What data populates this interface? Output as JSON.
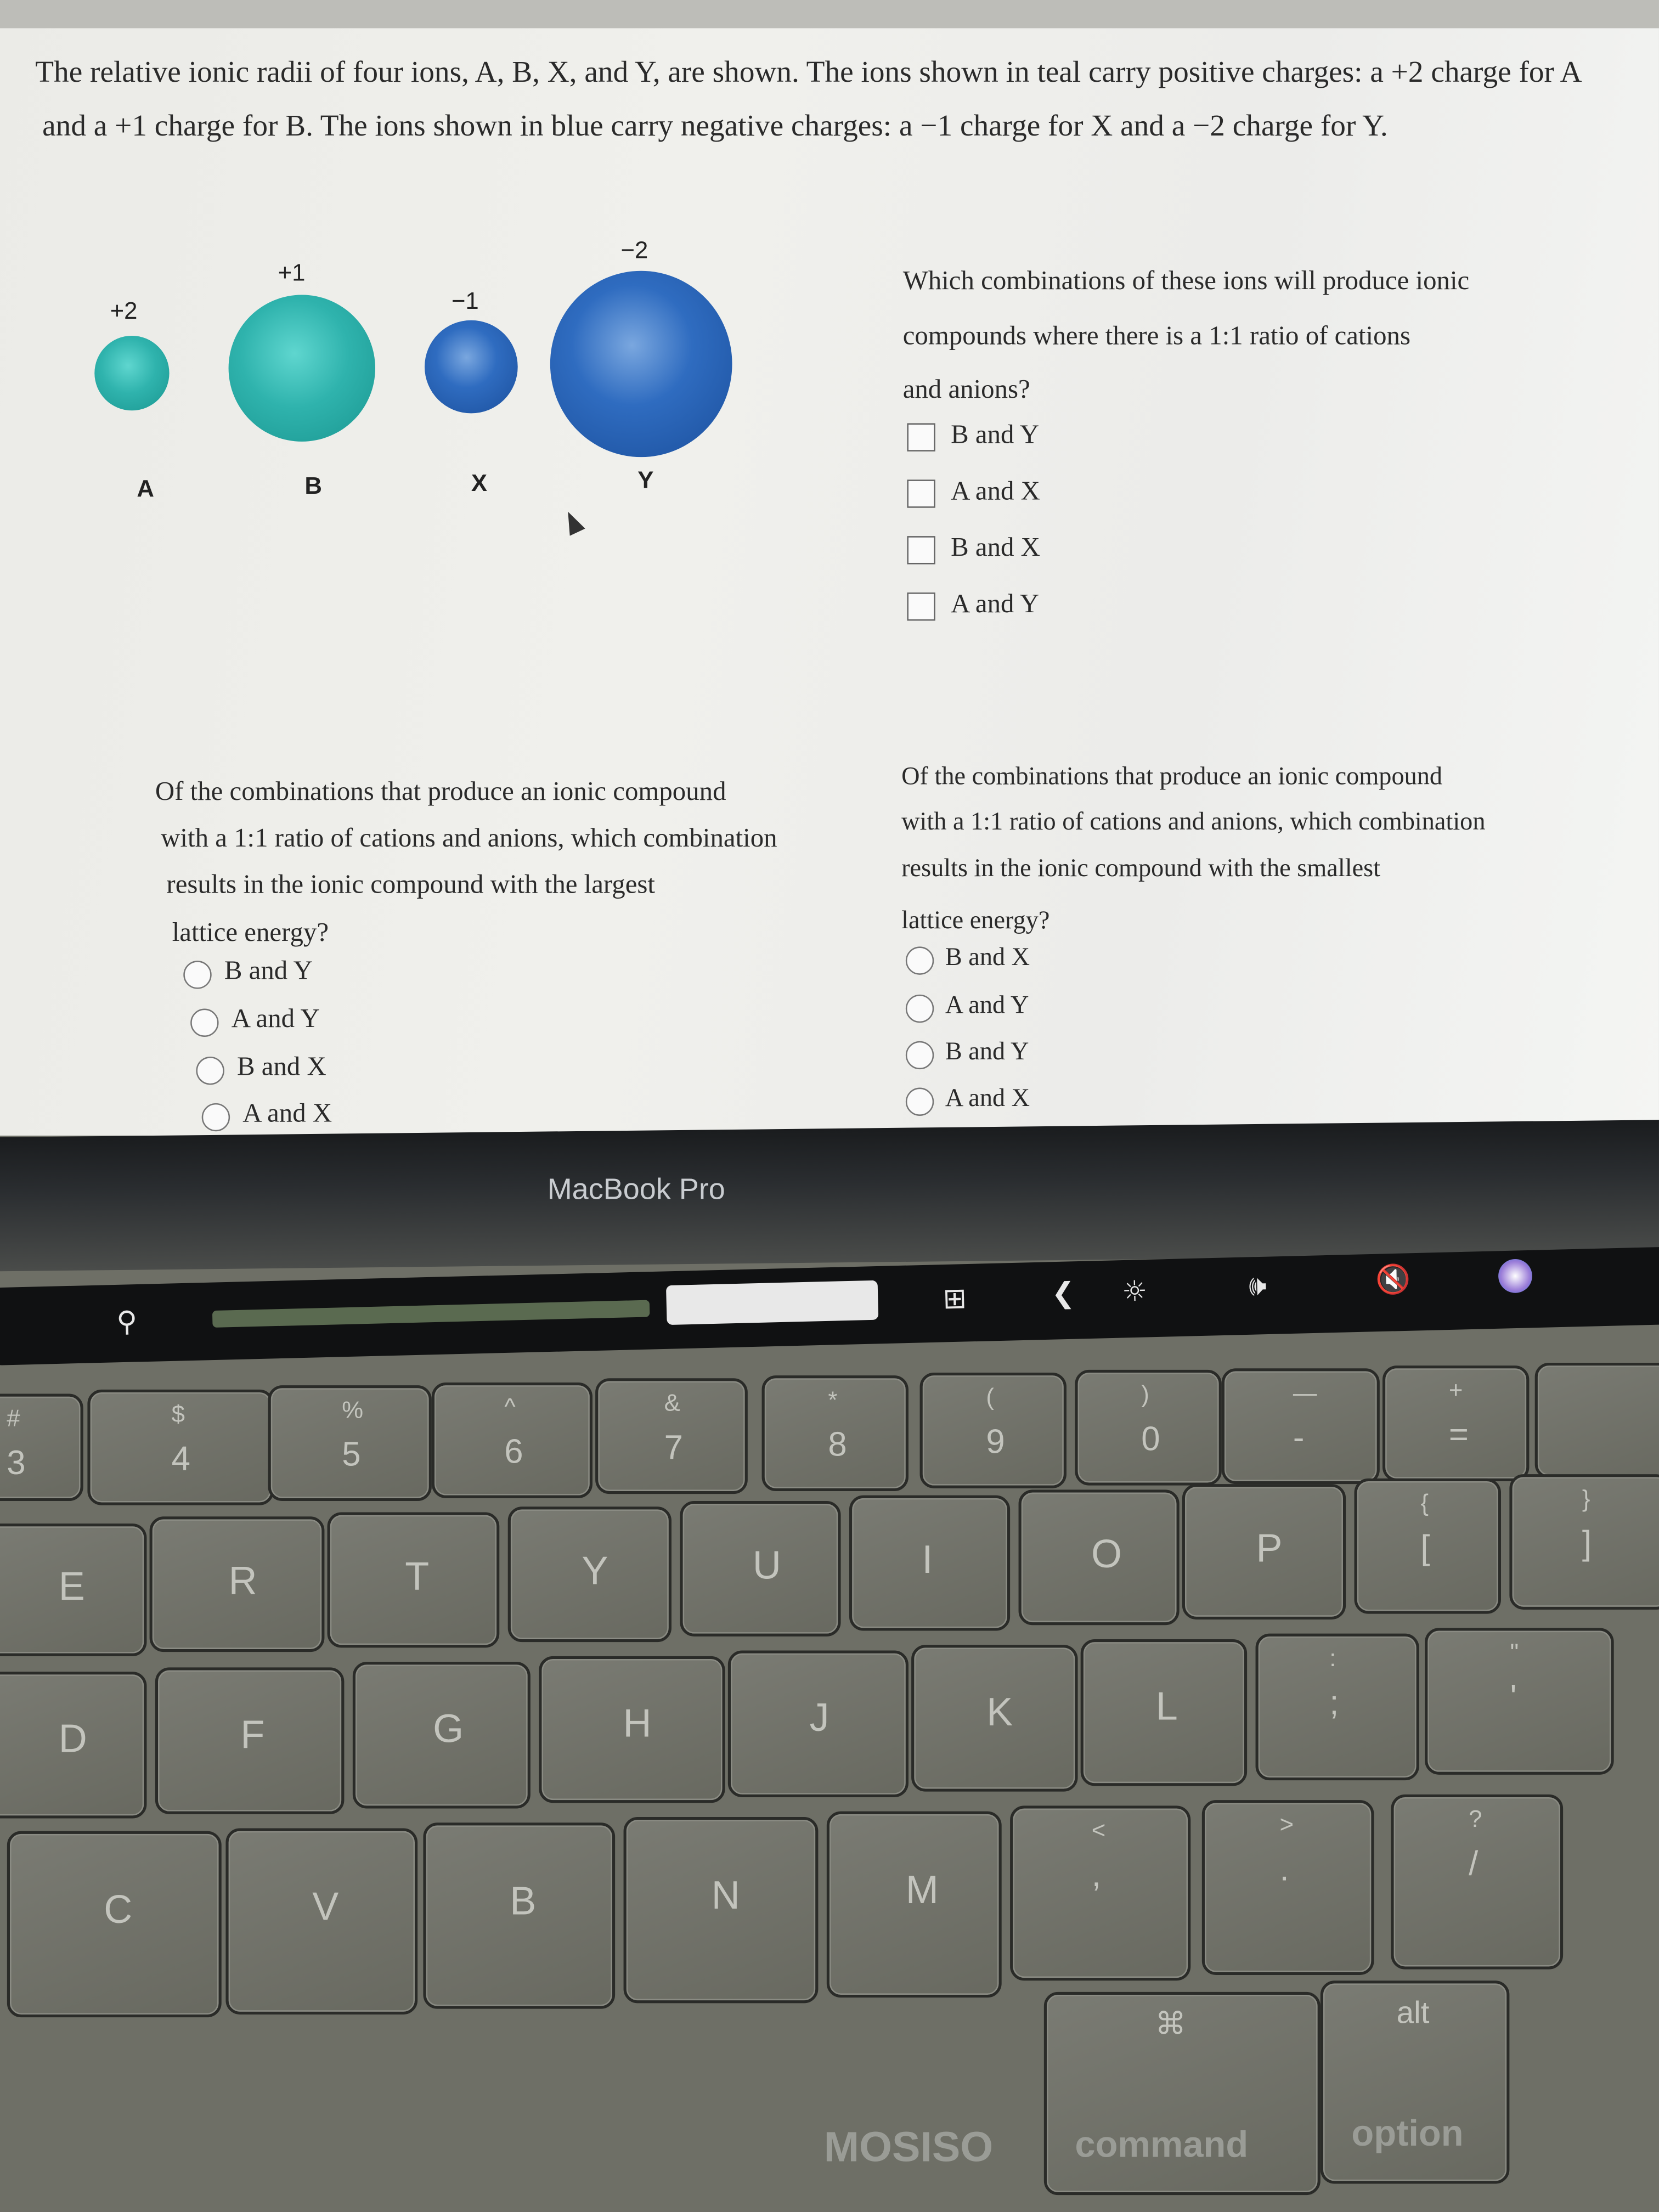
{
  "question_intro": {
    "line1": "The relative ionic radii of four ions, A, B, X, and Y, are shown. The ions shown in teal carry positive charges: a +2 charge for A",
    "line2": "and a +1 charge for B. The ions shown in blue carry negative charges: a −1 charge for X and a −2 charge for Y."
  },
  "ions": [
    {
      "label": "A",
      "charge": "+2",
      "color": "#2fb3ad"
    },
    {
      "label": "B",
      "charge": "+1",
      "color": "#2fb3ad"
    },
    {
      "label": "X",
      "charge": "−1",
      "color": "#2f6cc0"
    },
    {
      "label": "Y",
      "charge": "−2",
      "color": "#2f6cc0"
    }
  ],
  "q1": {
    "lines": [
      "Which combinations of these ions will produce ionic",
      "compounds where there is a 1:1 ratio of cations",
      "and anions?"
    ],
    "options": [
      "B and Y",
      "A and X",
      "B and X",
      "A and Y"
    ]
  },
  "q2": {
    "lines": [
      "Of the combinations that produce an ionic compound",
      "with a 1:1 ratio of cations and anions, which combination",
      "results in the ionic compound with the largest",
      "lattice energy?"
    ],
    "options": [
      "B and Y",
      "A and Y",
      "B and X",
      "A and X"
    ]
  },
  "q3": {
    "lines": [
      "Of the combinations that produce an ionic compound",
      "with a 1:1 ratio of cations and anions, which combination",
      "results in the ionic compound with the smallest",
      "lattice energy?"
    ],
    "options": [
      "B and X",
      "A and Y",
      "B and Y",
      "A and X"
    ]
  },
  "laptop": {
    "bezel_label": "MacBook Pro",
    "case_brand": "MOSISO",
    "touchbar_icons": [
      "search-icon",
      "screenshot-icon",
      "chevron-left-icon",
      "brightness-icon",
      "volume-icon",
      "mute-icon",
      "siri-icon"
    ]
  },
  "keyboard": {
    "keys": [
      {
        "top": "#",
        "main": "3"
      },
      {
        "top": "$",
        "main": "4"
      },
      {
        "top": "%",
        "main": "5"
      },
      {
        "top": "^",
        "main": "6"
      },
      {
        "top": "&",
        "main": "7"
      },
      {
        "top": "*",
        "main": "8"
      },
      {
        "top": "(",
        "main": "9"
      },
      {
        "top": ")",
        "main": "0"
      },
      {
        "top": "—",
        "main": "-"
      },
      {
        "top": "+",
        "main": "="
      },
      {
        "top": "",
        "main": ""
      },
      {
        "top": "",
        "main": "E"
      },
      {
        "top": "",
        "main": "R"
      },
      {
        "top": "",
        "main": "T"
      },
      {
        "top": "",
        "main": "Y"
      },
      {
        "top": "",
        "main": "U"
      },
      {
        "top": "",
        "main": "I"
      },
      {
        "top": "",
        "main": "O"
      },
      {
        "top": "",
        "main": "P"
      },
      {
        "top": "{",
        "main": "["
      },
      {
        "top": "}",
        "main": "]"
      },
      {
        "top": "",
        "main": "D"
      },
      {
        "top": "",
        "main": "F"
      },
      {
        "top": "",
        "main": "G"
      },
      {
        "top": "",
        "main": "H"
      },
      {
        "top": "",
        "main": "J"
      },
      {
        "top": "",
        "main": "K"
      },
      {
        "top": "",
        "main": "L"
      },
      {
        "top": ":",
        "main": ";"
      },
      {
        "top": "\"",
        "main": "'"
      },
      {
        "top": "",
        "main": "C"
      },
      {
        "top": "",
        "main": "V"
      },
      {
        "top": "",
        "main": "B"
      },
      {
        "top": "",
        "main": "N"
      },
      {
        "top": "",
        "main": "M"
      },
      {
        "top": "<",
        "main": ","
      },
      {
        "top": ">",
        "main": "."
      },
      {
        "top": "?",
        "main": "/"
      },
      {
        "top": "⌘",
        "main": "command"
      },
      {
        "top": "alt",
        "main": "option"
      }
    ]
  }
}
